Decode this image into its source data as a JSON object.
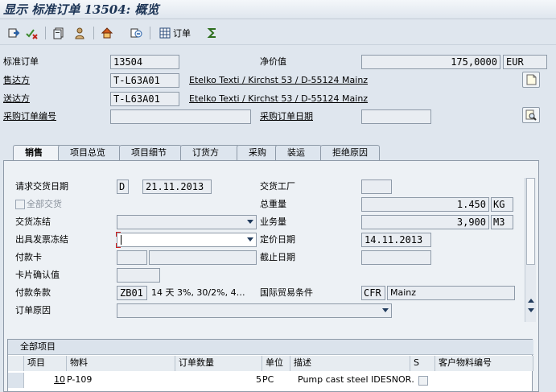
{
  "window": {
    "title": "显示 标准订单 13504: 概览"
  },
  "toolbar": {
    "order_button_label": "订单"
  },
  "header": {
    "order_type_label": "标准订单",
    "order_number": "13504",
    "net_value_label": "净价值",
    "net_value": "175,0000",
    "currency": "EUR",
    "sold_to_label": "售达方",
    "sold_to_value": "T-L63A01",
    "sold_to_address": "Etelko Texti / Kirchst 53 / D-55124 Mainz",
    "ship_to_label": "送达方",
    "ship_to_value": "T-L63A01",
    "ship_to_address": "Etelko Texti / Kirchst 53 / D-55124 Mainz",
    "po_number_label": "采购订单编号",
    "po_number": "",
    "po_date_label": "采购订单日期",
    "po_date": ""
  },
  "tabs": [
    {
      "label": "销售"
    },
    {
      "label": "项目总览"
    },
    {
      "label": "项目细节"
    },
    {
      "label": "订货方"
    },
    {
      "label": "采购"
    },
    {
      "label": "装运"
    },
    {
      "label": "拒绝原因"
    }
  ],
  "sales": {
    "req_delivery_date_label": "请求交货日期",
    "req_delivery_date_type": "D",
    "req_delivery_date": "21.11.2013",
    "delivery_plant_label": "交货工厂",
    "delivery_plant": "",
    "complete_delivery_label": "全部交货",
    "total_weight_label": "总重量",
    "total_weight": "1.450",
    "weight_unit": "KG",
    "delivery_block_label": "交货冻结",
    "delivery_block": "",
    "volume_label": "业务量",
    "volume": "3,900",
    "volume_unit": "M3",
    "billing_block_label": "出具发票冻结",
    "billing_block": "",
    "pricing_date_label": "定价日期",
    "pricing_date": "14.11.2013",
    "payment_card_label": "付款卡",
    "expiry_date_label": "截止日期",
    "card_verification_label": "卡片确认值",
    "payment_terms_label": "付款条款",
    "payment_terms_code": "ZB01",
    "payment_terms_text": "14 天  3%, 30/2%, 4…",
    "incoterms_label": "国际贸易条件",
    "incoterms_code": "CFR",
    "incoterms_place": "Mainz",
    "order_reason_label": "订单原因",
    "order_reason": ""
  },
  "items": {
    "title": "全部项目",
    "columns": [
      "项目",
      "物料",
      "订单数量",
      "单位",
      "描述",
      "S",
      "客户物料编号"
    ],
    "rows": [
      {
        "item": "10",
        "material": "P-109",
        "quantity": "5",
        "unit": "PC",
        "description": "Pump cast steel IDESNOR…",
        "s": "",
        "customer_material": ""
      }
    ]
  }
}
